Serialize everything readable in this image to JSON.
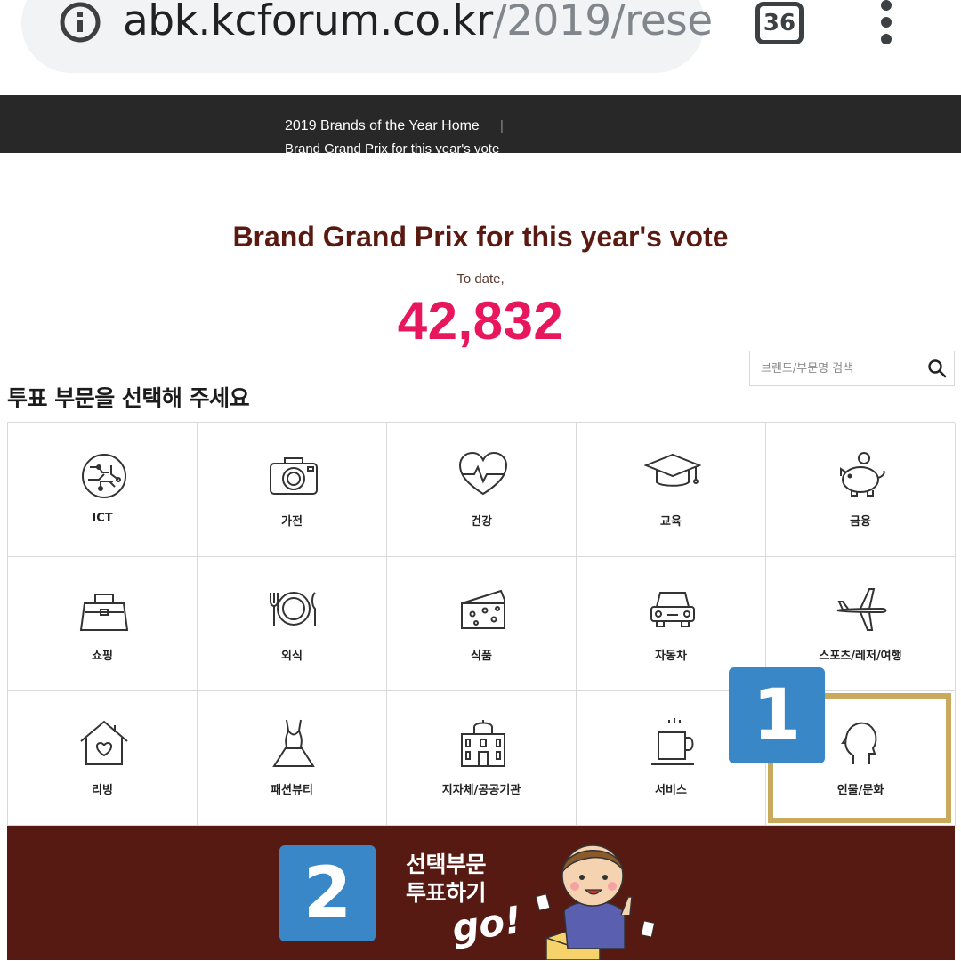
{
  "browser": {
    "url_domain": "abk.kcforum.co.kr",
    "url_path": "/2019/rese",
    "tab_count": "36"
  },
  "nav": {
    "home": "2019 Brands of the Year Home",
    "separator": "|",
    "vote": "Brand Grand Prix for this year's vote"
  },
  "main": {
    "title": "Brand Grand Prix for this year's vote",
    "to_date": "To date,",
    "count": "42,832",
    "section_heading": "투표 부문을 선택해 주세요"
  },
  "search": {
    "placeholder": "브랜드/부문명 검색"
  },
  "categories": [
    {
      "label": "ICT",
      "icon": "globe-circuit-icon"
    },
    {
      "label": "가전",
      "icon": "camera-icon"
    },
    {
      "label": "건강",
      "icon": "heart-pulse-icon"
    },
    {
      "label": "교육",
      "icon": "graduation-cap-icon"
    },
    {
      "label": "금융",
      "icon": "piggy-bank-icon"
    },
    {
      "label": "쇼핑",
      "icon": "handbag-icon"
    },
    {
      "label": "외식",
      "icon": "plate-cutlery-icon"
    },
    {
      "label": "식품",
      "icon": "cheese-icon"
    },
    {
      "label": "자동차",
      "icon": "car-icon"
    },
    {
      "label": "스포츠/레저/여행",
      "icon": "airplane-icon"
    },
    {
      "label": "리빙",
      "icon": "house-heart-icon"
    },
    {
      "label": "패션뷰티",
      "icon": "dress-icon"
    },
    {
      "label": "지자체/공공기관",
      "icon": "government-building-icon"
    },
    {
      "label": "서비스",
      "icon": "coffee-cup-icon"
    },
    {
      "label": "인물/문화",
      "icon": "person-head-icon",
      "selected": true
    }
  ],
  "badges": {
    "step1": "1",
    "step2": "2"
  },
  "banner": {
    "line1": "선택부문",
    "line2": "투표하기",
    "go": "go!",
    "background": "#561a13"
  },
  "colors": {
    "title": "#5a1a12",
    "count": "#e8175d",
    "badge": "#3a87c7",
    "selected_border": "#c9a95c",
    "navbar": "#282828"
  }
}
